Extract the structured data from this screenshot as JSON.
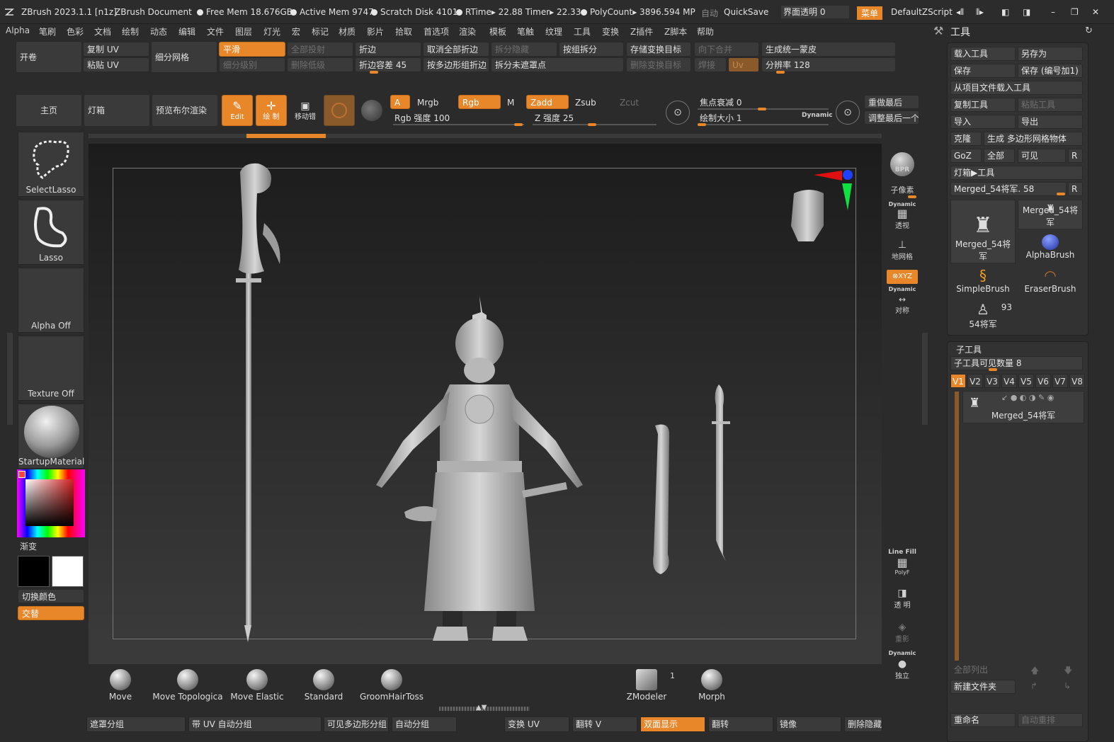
{
  "titlebar": {
    "app": "ZBrush 2023.1.1 [n1z]",
    "doc": "ZBrush Document",
    "free_mem": "Free Mem 18.676GB",
    "active_mem": "Active Mem 9747",
    "scratch": "Scratch Disk 4101",
    "rtime": "RTime▸ 22.88 Timer▸ 22.33",
    "polycount": "PolyCount▸ 3896.594 MP",
    "auto": "自动",
    "quicksave": "QuickSave",
    "transparency": "界面透明 0",
    "menu": "菜单",
    "script": "DefaultZScript"
  },
  "menubar": [
    "Alpha",
    "笔刷",
    "色彩",
    "文档",
    "绘制",
    "动态",
    "编辑",
    "文件",
    "图层",
    "灯光",
    "宏",
    "标记",
    "材质",
    "影片",
    "拾取",
    "首选项",
    "渲染",
    "模板",
    "笔触",
    "纹理",
    "工具",
    "变换",
    "Z插件",
    "Z脚本",
    "帮助"
  ],
  "shelf": {
    "open": "开卷",
    "copy_uv": "复制 UV",
    "paste_uv": "粘贴 UV",
    "subdiv_mesh": "细分网格",
    "smooth": "平滑",
    "subdiv_level": "细分级别",
    "project_all": "全部投射",
    "del_lower": "删除低级",
    "crease": "折边",
    "crease_tol": "折边容差 45",
    "uncrease_all": "取消全部折边",
    "split_poly": "按多边形组折边",
    "split_hidden": "拆分隐藏",
    "split_unmasked": "拆分未遮罩点",
    "group_split": "按组拆分",
    "store_morph": "存储变换目标",
    "del_morph": "删除变换目标",
    "merge_down": "向下合并",
    "weld": "焊接",
    "uv": "Uv",
    "unify_skin": "生成统一蒙皮",
    "resolution": "分辨率 128"
  },
  "toolbar": {
    "home": "主页",
    "lightbox": "灯箱",
    "bpr_preview": "预览布尔渲染",
    "edit": "Edit",
    "draw": "绘 制",
    "gizmo": "移动错",
    "a": "A",
    "mrgb": "Mrgb",
    "rgb": "Rgb",
    "m": "M",
    "zadd": "Zadd",
    "zsub": "Zsub",
    "zcut": "Zcut",
    "rgb_intensity": "Rgb 强度 100",
    "z_intensity": "Z 强度 25",
    "focal_shift": "焦点衰减 0",
    "draw_size": "绘制大小 1",
    "dynamic": "Dynamic",
    "redo_last": "重做最后",
    "adjust_last": "调整最后一个"
  },
  "left": {
    "select_lasso": "SelectLasso",
    "lasso": "Lasso",
    "alpha_off": "Alpha Off",
    "texture_off": "Texture Off",
    "material": "StartupMaterial",
    "gradient": "渐变",
    "switch_color": "切换颜色",
    "alternate": "交替"
  },
  "right_tools": {
    "bpr": "BPR",
    "subpixel": "子像素",
    "dynamic": "Dynamic",
    "persp": "透视",
    "floor": "地网格",
    "xyz": "XYZ",
    "symmetry": "对称",
    "linefill": "Line Fill",
    "polyf": "PolyF",
    "transp": "透 明",
    "ghost": "重影",
    "solo": "独立"
  },
  "tool_panel": {
    "title": "工具",
    "load": "载入工具",
    "save_as": "另存为",
    "save": "保存",
    "save_inc": "保存 (编号加1)",
    "load_project": "从项目文件载入工具",
    "copy_tool": "复制工具",
    "paste_tool": "粘贴工具",
    "import": "导入",
    "export": "导出",
    "clone": "克隆",
    "make_polymesh": "生成 多边形网格物体",
    "goz": "GoZ",
    "all": "全部",
    "visible": "可见",
    "r": "R",
    "lightbox_tool": "灯箱▶工具",
    "current_tool": "Merged_54将军. 58",
    "thumbs": [
      "Merged_54将军",
      "Merged_54将军",
      "AlphaBrush",
      "SimpleBrush",
      "EraserBrush",
      "54将军"
    ],
    "thumb_count": "93"
  },
  "subtool": {
    "title": "子工具",
    "visible_count": "子工具可见数量 8",
    "tabs": [
      "V1",
      "V2",
      "V3",
      "V4",
      "V5",
      "V6",
      "V7",
      "V8"
    ],
    "item": "Merged_54将军",
    "list_all": "全部列出",
    "new_folder": "新建文件夹",
    "rename": "重命名",
    "auto_reorder": "自动重排"
  },
  "brushes": [
    "Move",
    "Move Topologica",
    "Move Elastic",
    "Standard",
    "GroomHairToss",
    "ZModeler",
    "Morph"
  ],
  "zmodeler_count": "1",
  "bottom": [
    "遮罩分组",
    "带 UV 自动分组",
    "可见多边形分组",
    "自动分组",
    "变换 UV",
    "翻转 V",
    "双面显示",
    "翻转",
    "镜像",
    "删除隐藏"
  ]
}
